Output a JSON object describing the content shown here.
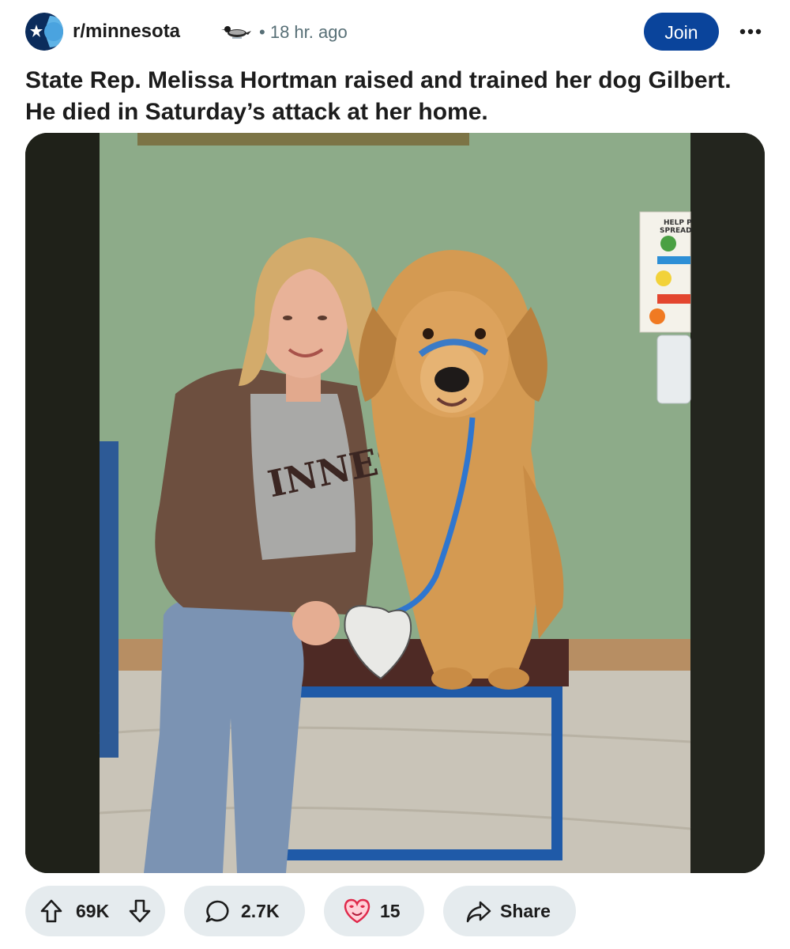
{
  "post": {
    "subreddit": "r/minnesota",
    "age": "18 hr. ago",
    "meta_separator": "•",
    "title": "State Rep. Melissa Hortman raised and trained her dog Gilbert. He died in Saturday’s attack at her home.",
    "join_label": "Join",
    "flair_icon": "loon-icon"
  },
  "actions": {
    "upvotes": "69K",
    "comments": "2.7K",
    "awards": "15",
    "share_label": "Share"
  },
  "media": {
    "poster_text": "HELP P\nSPREAD",
    "shirt_text": "INNES"
  },
  "colors": {
    "join_bg": "#0a449b",
    "pill_bg": "#e5ebee",
    "meta_text": "#576f76",
    "wall": "#8caa88"
  }
}
